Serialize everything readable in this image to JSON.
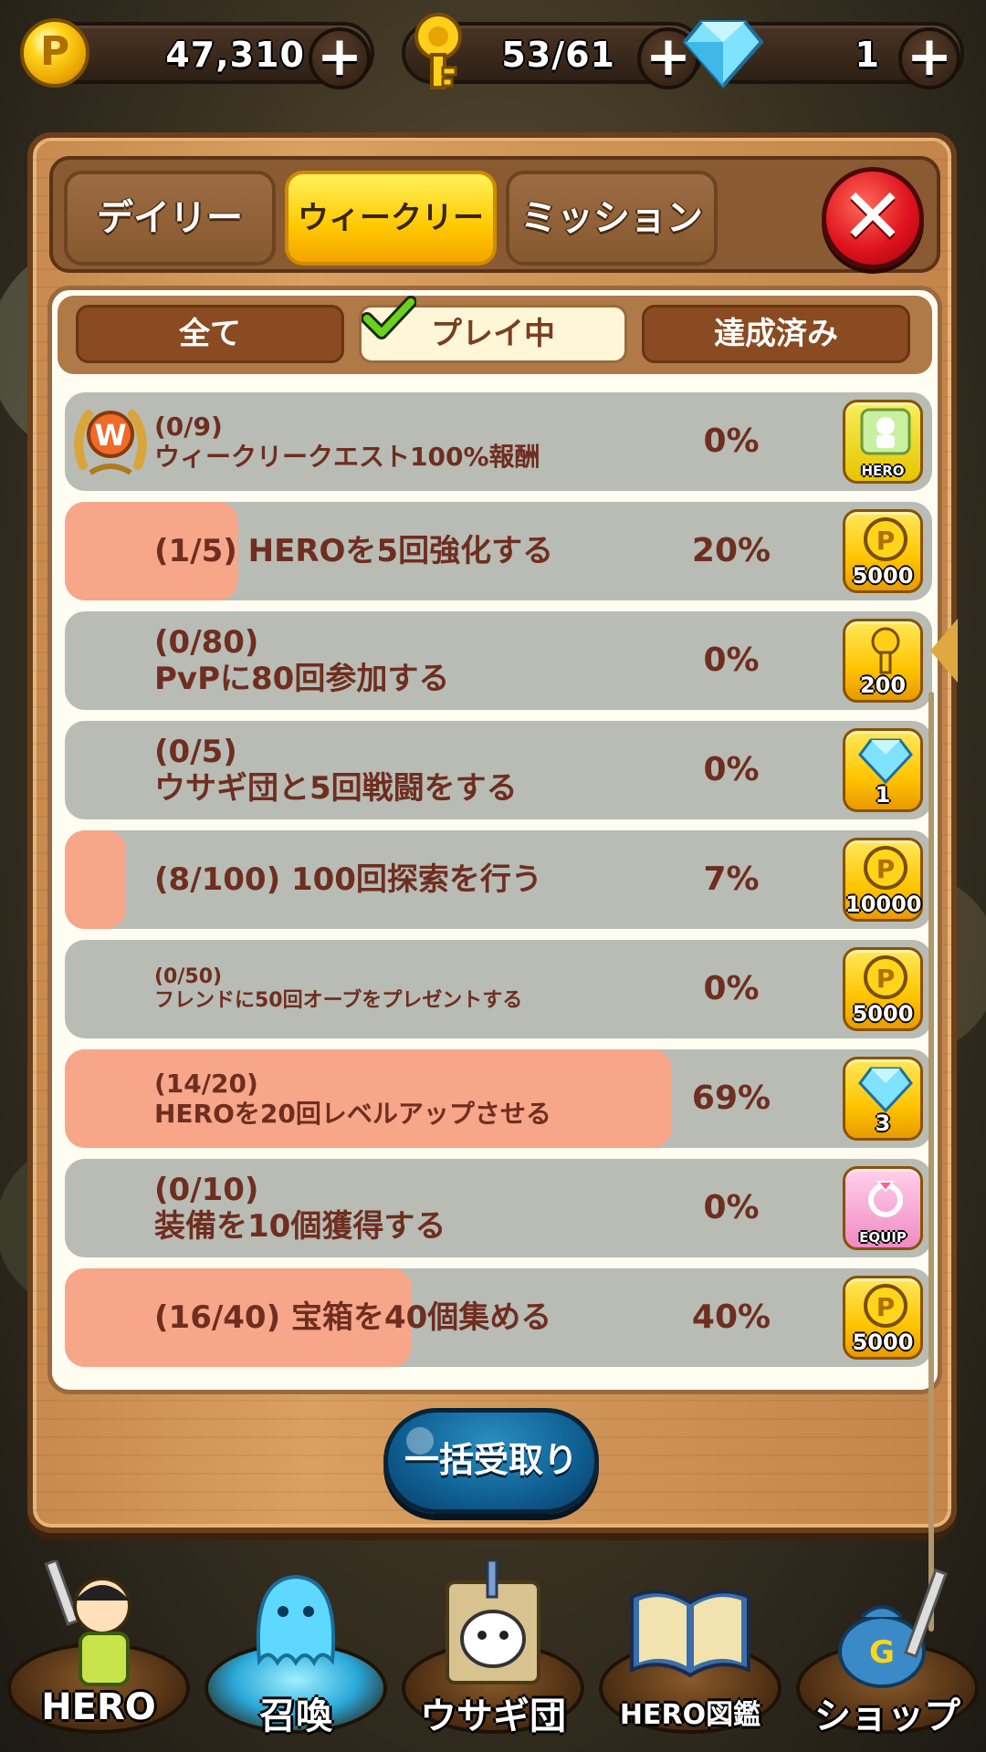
{
  "currency": {
    "coins": "47,310",
    "keys": "53/61",
    "gems": "1",
    "plus": "+",
    "coin_symbol": "P"
  },
  "tabs": {
    "daily": "デイリー",
    "weekly": "ウィークリー",
    "mission": "ミッション",
    "close": "✕",
    "active": "weekly"
  },
  "filters": {
    "all": "全て",
    "playing": "プレイ中",
    "done": "達成済み",
    "active": "playing"
  },
  "quests": [
    {
      "line1": "(0/9)",
      "line2": "ウィークリークエスト100%報酬",
      "percent": "0%",
      "progress": 0,
      "reward_icon": "hero-ticket-icon",
      "reward_label": "HERO"
    },
    {
      "line1": "(1/5) HEROを5回強化する",
      "line2": "",
      "percent": "20%",
      "progress": 0.2,
      "reward_icon": "coin-icon",
      "reward_label": "5000"
    },
    {
      "line1": "(0/80)",
      "line2": "PvPに80回参加する",
      "percent": "0%",
      "progress": 0,
      "reward_icon": "key-icon",
      "reward_label": "200"
    },
    {
      "line1": "(0/5)",
      "line2": "ウサギ団と5回戦闘をする",
      "percent": "0%",
      "progress": 0,
      "reward_icon": "gem-icon",
      "reward_label": "1"
    },
    {
      "line1": "(8/100) 100回探索を行う",
      "line2": "",
      "percent": "7%",
      "progress": 0.07,
      "reward_icon": "coin-icon",
      "reward_label": "10000"
    },
    {
      "line1": "(0/50)",
      "line2": "フレンドに50回オーブをプレゼントする",
      "percent": "0%",
      "progress": 0,
      "reward_icon": "coin-icon",
      "reward_label": "5000"
    },
    {
      "line1": "(14/20)",
      "line2": "HEROを20回レベルアップさせる",
      "percent": "69%",
      "progress": 0.7,
      "reward_icon": "gem-icon",
      "reward_label": "3"
    },
    {
      "line1": "(0/10)",
      "line2": "装備を10個獲得する",
      "percent": "0%",
      "progress": 0,
      "reward_icon": "equip-ring-icon",
      "reward_label": "EQUIP"
    },
    {
      "line1": "(16/40) 宝箱を40個集める",
      "line2": "",
      "percent": "40%",
      "progress": 0.4,
      "reward_icon": "coin-icon",
      "reward_label": "5000"
    }
  ],
  "claim_all": "一括受取り",
  "nav": [
    {
      "label": "HERO",
      "icon": "hero-character-icon"
    },
    {
      "label": "召喚",
      "icon": "summon-ghost-icon"
    },
    {
      "label": "ウサギ団",
      "icon": "rabbit-gang-icon"
    },
    {
      "label": "HERO図鑑",
      "icon": "hero-encyclopedia-icon"
    },
    {
      "label": "ショップ",
      "icon": "shop-bag-icon"
    }
  ],
  "colors": {
    "progress_fill": "#f7a68a",
    "row_bg": "#b8bcb4",
    "text_brown": "#6e2e20",
    "active_tab": "#ffc800",
    "claim_button": "#105f93",
    "close_button": "#e0141e"
  }
}
